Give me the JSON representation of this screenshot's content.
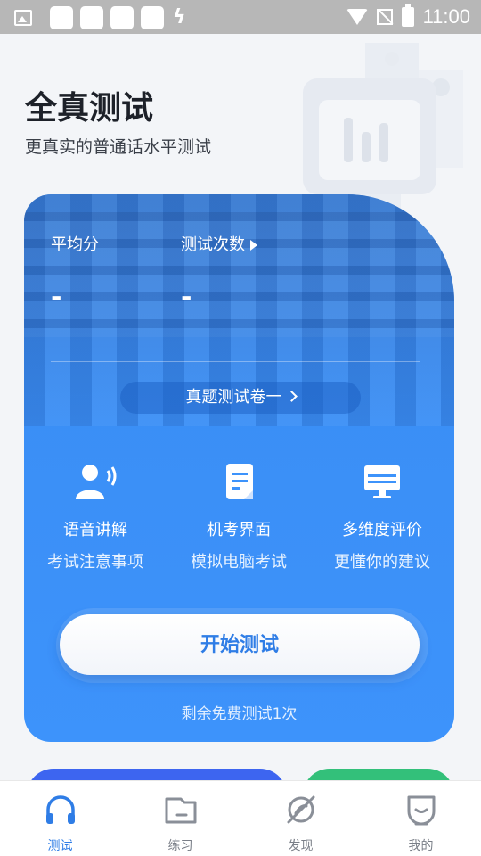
{
  "status_bar": {
    "time": "11:00"
  },
  "header": {
    "title": "全真测试",
    "subtitle": "更真实的普通话水平测试"
  },
  "card": {
    "stats": {
      "average_label": "平均分",
      "average_value": "-",
      "count_label": "测试次数",
      "count_value": "-"
    },
    "paper_selector": "真题测试卷一",
    "features": [
      {
        "title": "语音讲解",
        "desc": "考试注意事项",
        "icon": "voice-user-icon"
      },
      {
        "title": "机考界面",
        "desc": "模拟电脑考试",
        "icon": "document-icon"
      },
      {
        "title": "多维度评价",
        "desc": "更懂你的建议",
        "icon": "monitor-icon"
      }
    ],
    "start_button": "开始测试",
    "remaining_text": "剩余免费测试1次"
  },
  "tabs": [
    {
      "label": "测试",
      "icon": "headphones-icon",
      "active": true
    },
    {
      "label": "练习",
      "icon": "practice-board-icon",
      "active": false
    },
    {
      "label": "发现",
      "icon": "discover-icon",
      "active": false
    },
    {
      "label": "我的",
      "icon": "profile-icon",
      "active": false
    }
  ],
  "colors": {
    "accent": "#2f7de6",
    "card": "#3d93fb",
    "peek_blue": "#3d65f0",
    "peek_green": "#33c07a"
  }
}
